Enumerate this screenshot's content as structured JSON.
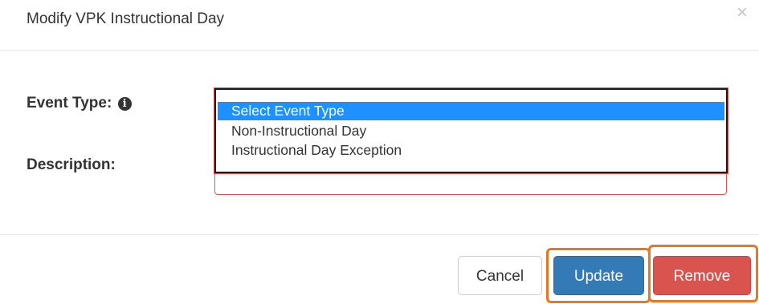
{
  "modal": {
    "title": "Modify VPK Instructional Day",
    "close_glyph": "×"
  },
  "form": {
    "event_type_label": "Event Type:",
    "info_glyph": "i",
    "description_label": "Description:",
    "event_type_options": [
      "Select Event Type",
      "Non-Instructional Day",
      "Instructional Day Exception"
    ],
    "selected_option_index": 0
  },
  "footer": {
    "cancel_label": "Cancel",
    "update_label": "Update",
    "remove_label": "Remove"
  },
  "colors": {
    "primary": "#337ab7",
    "danger": "#d9534f",
    "selected_option": "#1e90ff",
    "annotation_highlight": "#e87722"
  },
  "icons": {
    "close": "close-icon",
    "info": "info-circle-icon"
  }
}
